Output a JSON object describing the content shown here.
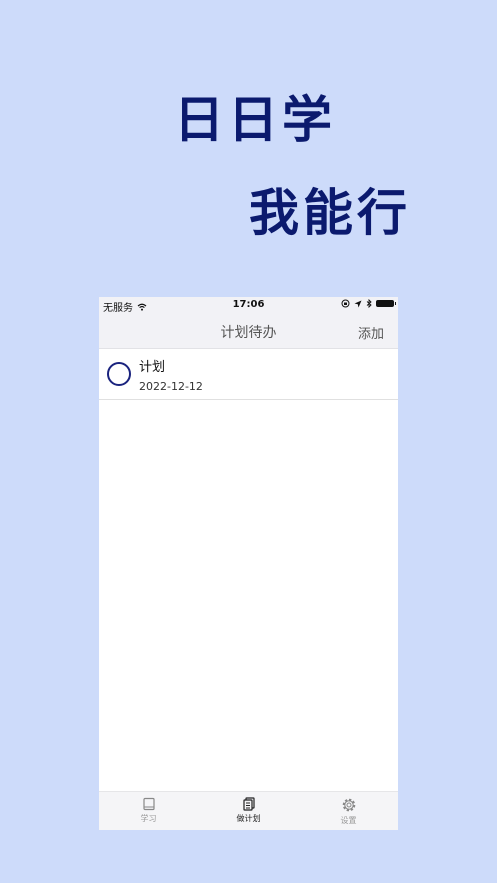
{
  "headline": {
    "line1": "日日学",
    "line2": "我能行"
  },
  "status_bar": {
    "carrier": "无服务",
    "time": "17:06"
  },
  "nav": {
    "title": "计划待办",
    "add_label": "添加"
  },
  "todos": [
    {
      "title": "计划",
      "date": "2022-12-12"
    }
  ],
  "tabs": [
    {
      "label": "学习",
      "icon": "book-icon",
      "active": false
    },
    {
      "label": "做计划",
      "icon": "notes-icon",
      "active": true
    },
    {
      "label": "设置",
      "icon": "gear-icon",
      "active": false
    }
  ],
  "colors": {
    "background": "#cddbfa",
    "headline": "#0b1a6e",
    "check_ring": "#1a237e"
  }
}
